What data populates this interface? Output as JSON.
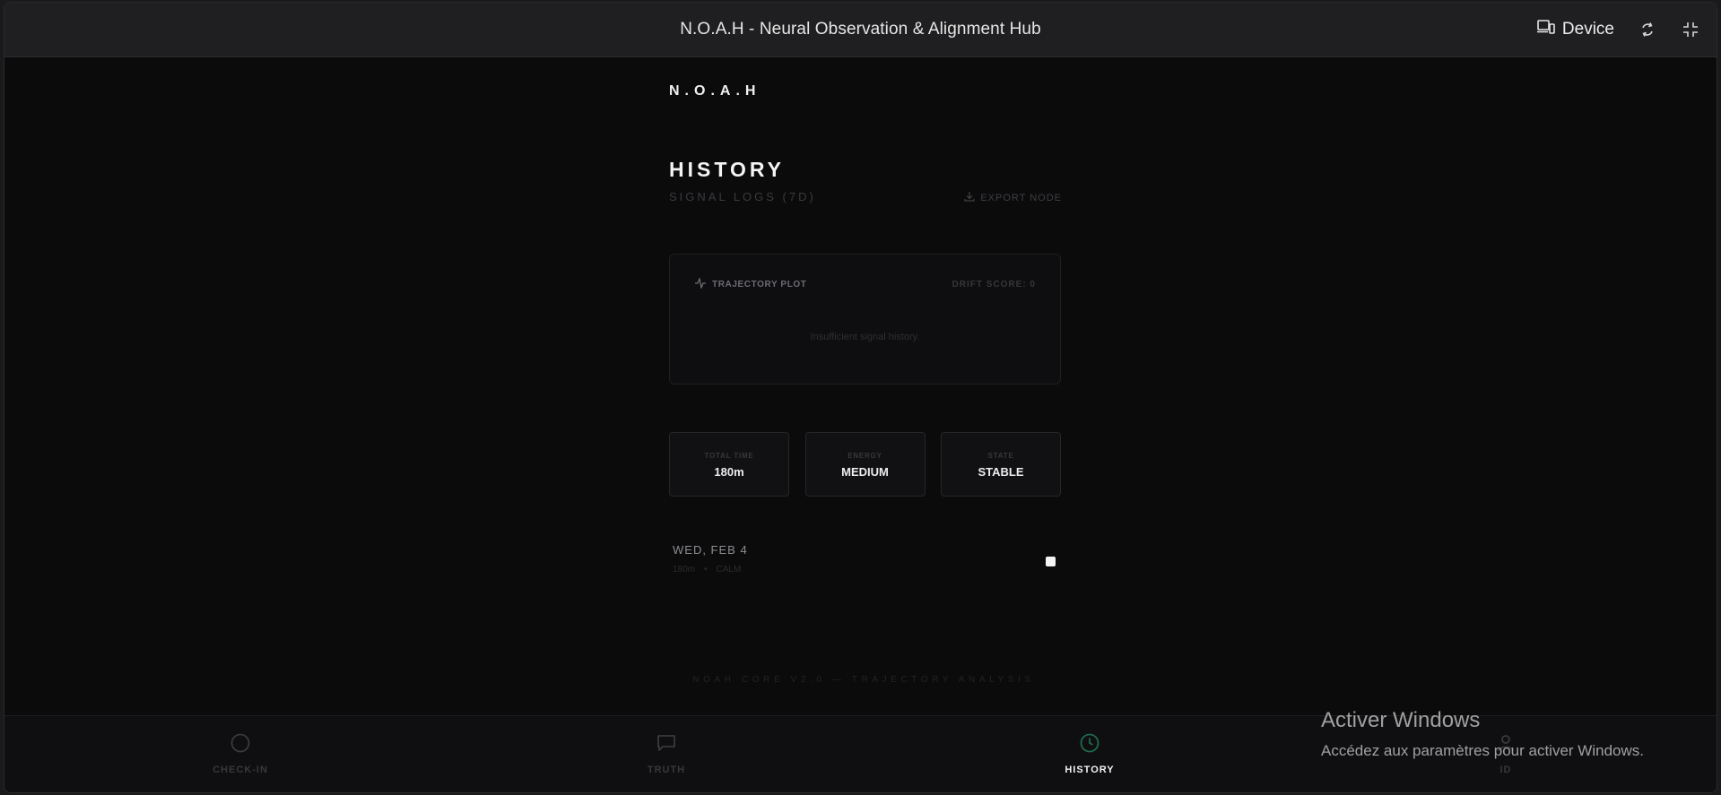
{
  "window": {
    "title": "N.O.A.H - Neural Observation & Alignment Hub",
    "device_label": "Device"
  },
  "brand": "N.O.A.H",
  "page": {
    "title": "HISTORY",
    "subtitle": "SIGNAL LOGS (7D)",
    "export_label": "EXPORT NODE"
  },
  "plot": {
    "label": "TRAJECTORY PLOT",
    "drift": "DRIFT SCORE: 0",
    "empty_message": "Insufficient signal history."
  },
  "stats": [
    {
      "label": "TOTAL TIME",
      "value": "180m"
    },
    {
      "label": "ENERGY",
      "value": "MEDIUM"
    },
    {
      "label": "STATE",
      "value": "STABLE"
    }
  ],
  "log": {
    "date": "WED, FEB 4",
    "duration": "180m",
    "separator": "•",
    "mood": "CALM"
  },
  "footer_note": "NOAH CORE V2.0 — TRAJECTORY ANALYSIS",
  "nav": [
    {
      "label": "CHECK-IN",
      "icon": "circle-icon",
      "active": false
    },
    {
      "label": "TRUTH",
      "icon": "chat-bubble-icon",
      "active": false
    },
    {
      "label": "HISTORY",
      "icon": "clock-icon",
      "active": true
    },
    {
      "label": "ID",
      "icon": "user-icon",
      "active": false
    }
  ],
  "watermark": {
    "title": "Activer Windows",
    "subtitle": "Accédez aux paramètres pour activer Windows."
  },
  "colors": {
    "accent_active": "#1f6b4a",
    "background": "#0b0b0c"
  }
}
